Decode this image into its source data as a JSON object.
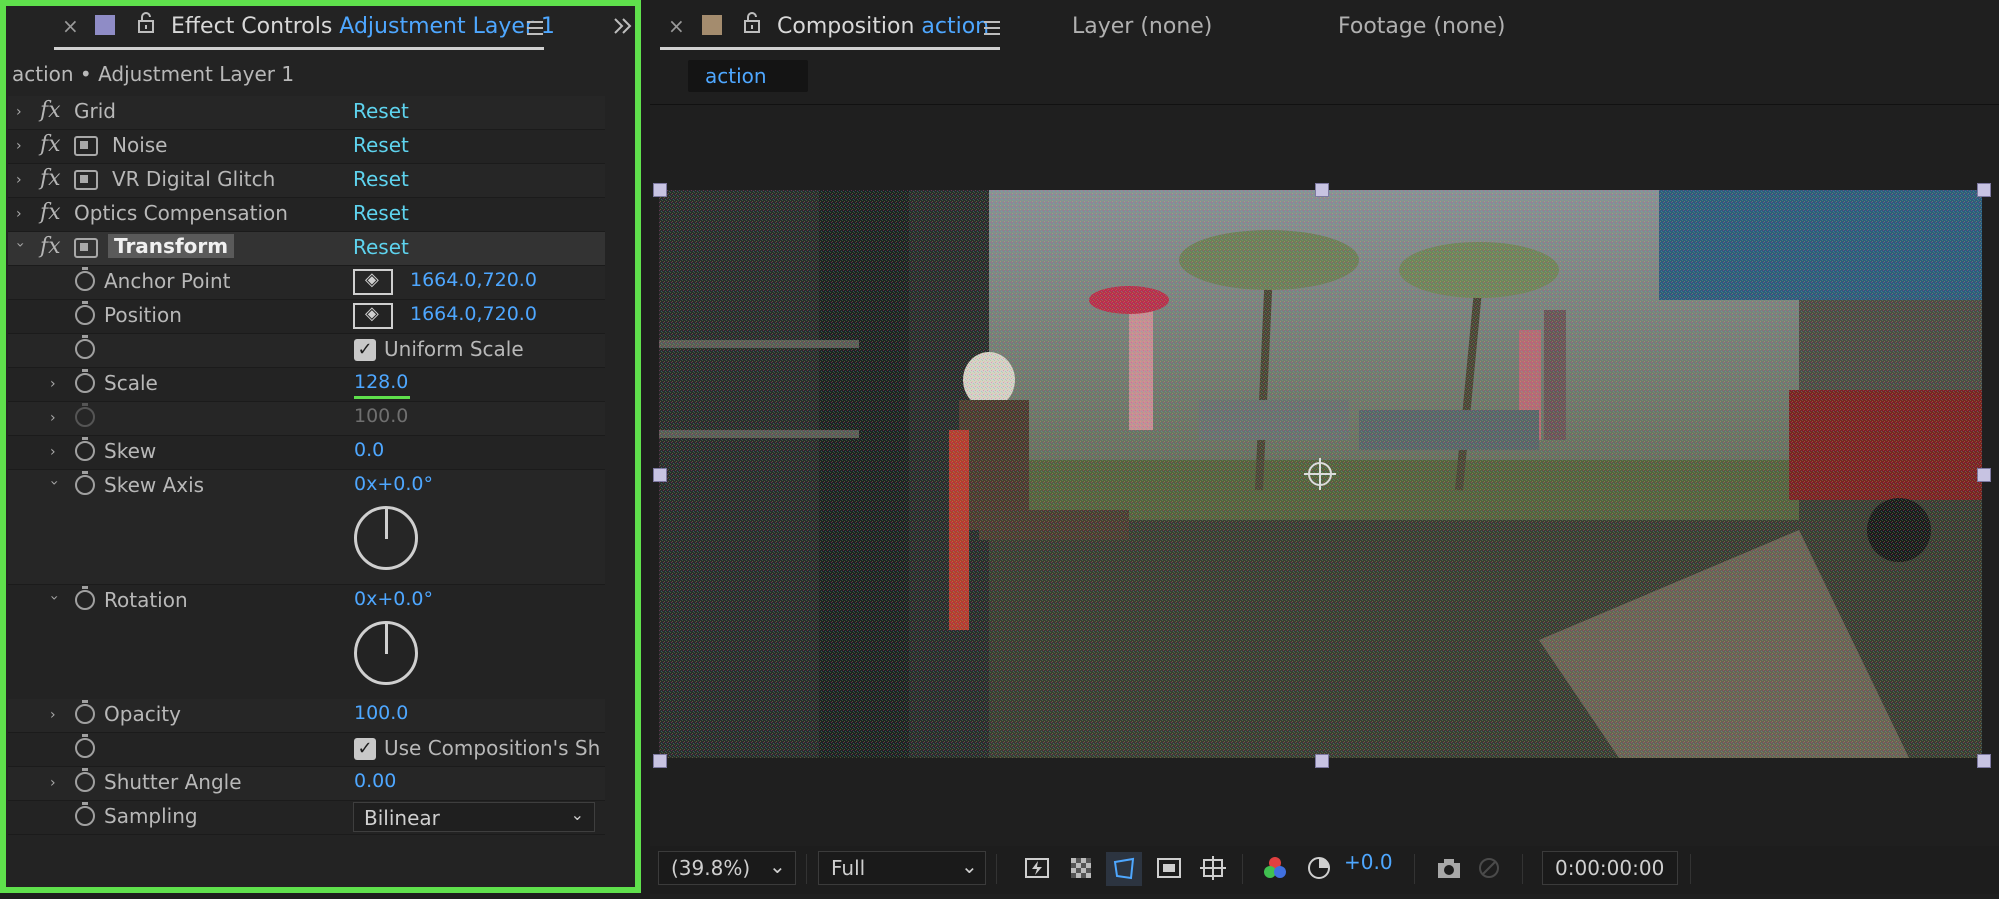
{
  "effect_controls": {
    "tab_prefix": "Effect Controls",
    "tab_layer": "Adjustment Layer 1",
    "subtitle": "action • Adjustment Layer 1",
    "effects": [
      {
        "name": "Grid",
        "reset": "Reset"
      },
      {
        "name": "Noise",
        "reset": "Reset"
      },
      {
        "name": "VR Digital Glitch",
        "reset": "Reset"
      },
      {
        "name": "Optics Compensation",
        "reset": "Reset"
      },
      {
        "name": "Transform",
        "reset": "Reset"
      }
    ],
    "transform": {
      "anchor_point": {
        "label": "Anchor Point",
        "value": "1664.0,720.0"
      },
      "position": {
        "label": "Position",
        "value": "1664.0,720.0"
      },
      "uniform_scale": {
        "label": "Uniform Scale",
        "checked": true
      },
      "scale": {
        "label": "Scale",
        "value": "128.0"
      },
      "scale_width": {
        "label": "",
        "value": "100.0"
      },
      "skew": {
        "label": "Skew",
        "value": "0.0"
      },
      "skew_axis": {
        "label": "Skew Axis",
        "value": "0x+0.0°"
      },
      "rotation": {
        "label": "Rotation",
        "value": "0x+0.0°"
      },
      "opacity": {
        "label": "Opacity",
        "value": "100.0"
      },
      "use_comp_shutter": {
        "label": "Use Composition's Sh",
        "checked": true
      },
      "shutter_angle": {
        "label": "Shutter Angle",
        "value": "0.00"
      },
      "sampling": {
        "label": "Sampling",
        "value": "Bilinear"
      }
    }
  },
  "composition": {
    "tab_prefix": "Composition",
    "tab_name": "action",
    "layer_tab": "Layer (none)",
    "footage_tab": "Footage (none)",
    "comp_pill": "action"
  },
  "viewer_bar": {
    "zoom": "(39.8%)",
    "resolution": "Full",
    "exposure": "+0.0",
    "timecode": "0:00:00:00"
  },
  "colors": {
    "panel_highlight": "#5fe04c",
    "accent_blue": "#4ea7ff",
    "reset_cyan": "#5ed3ee",
    "handle": "#c7c3e2"
  }
}
